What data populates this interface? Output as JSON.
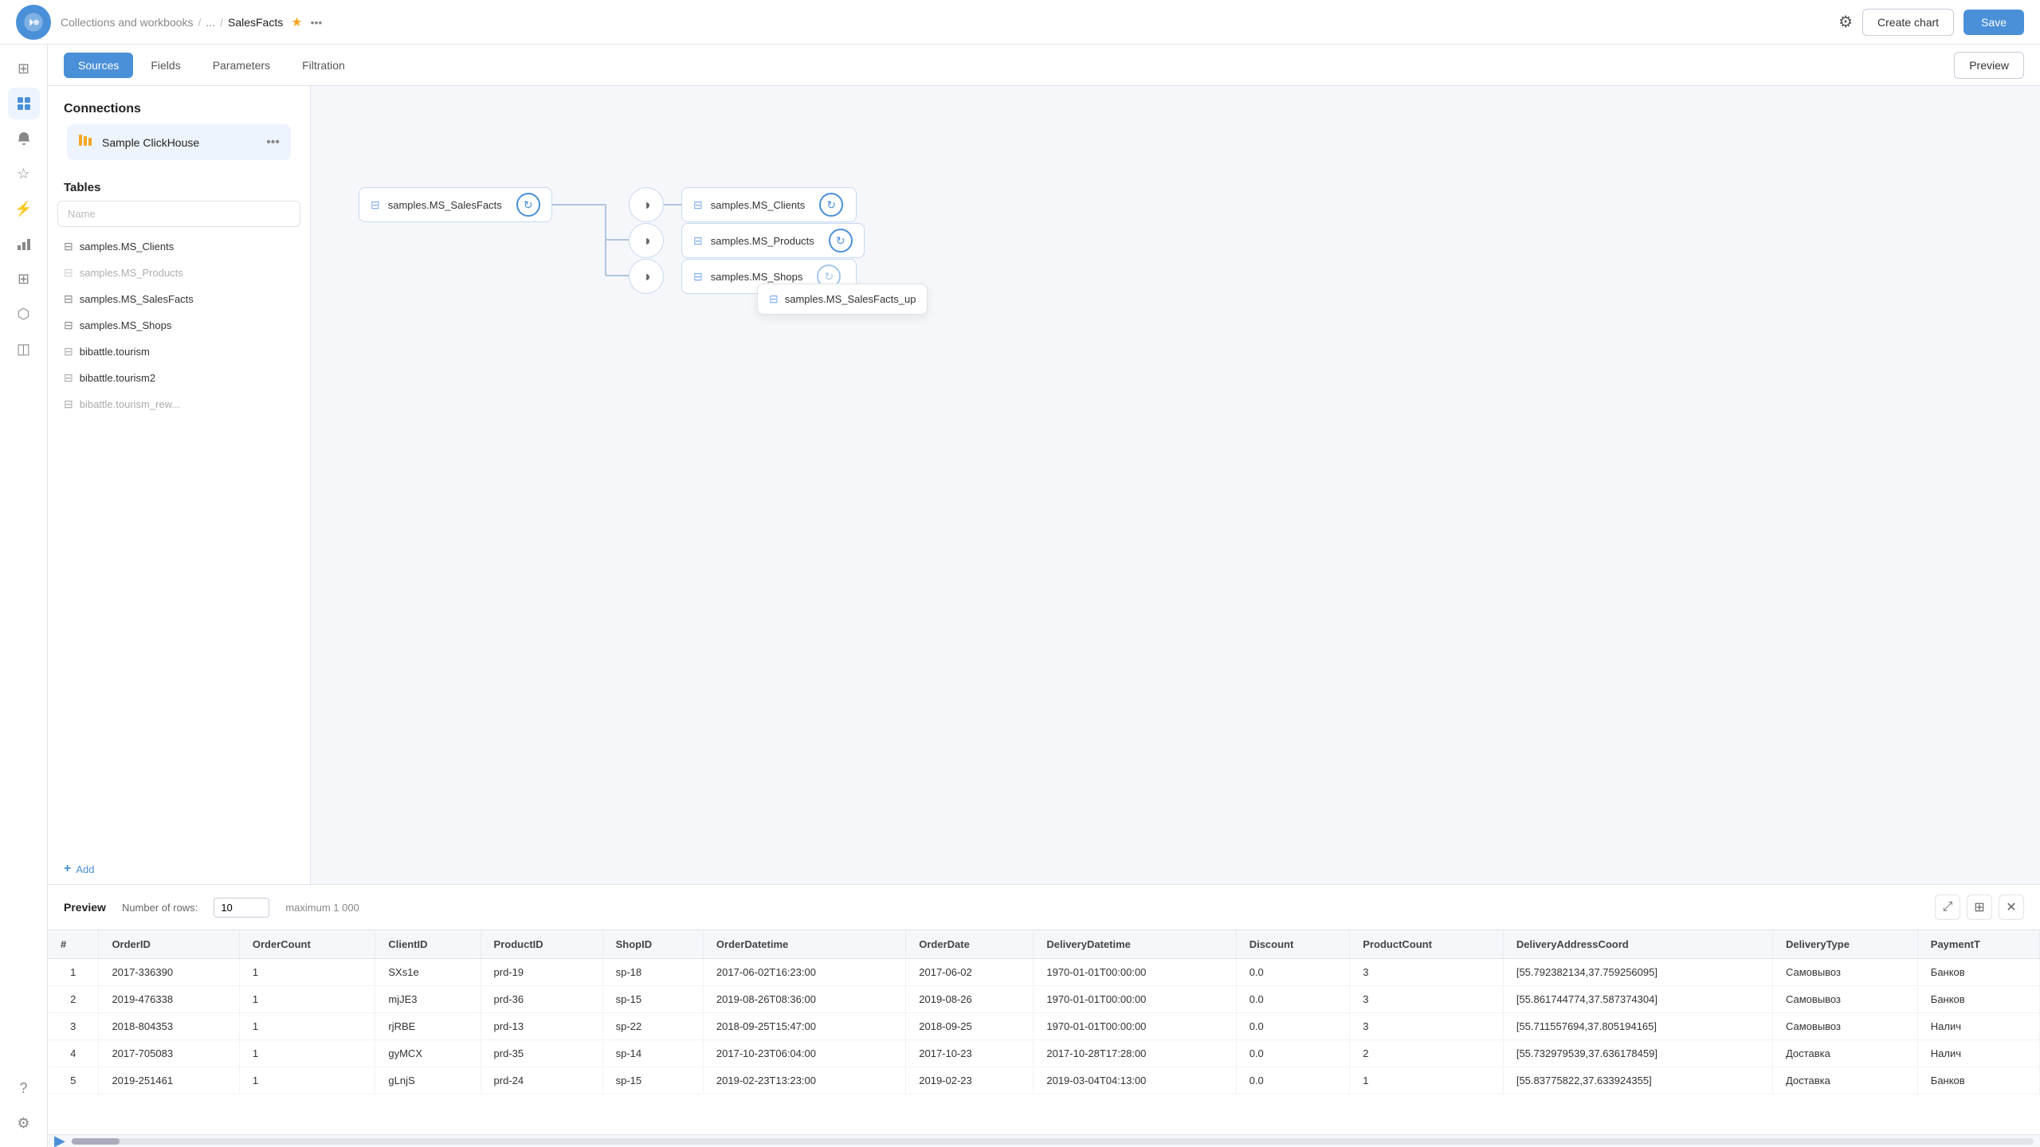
{
  "topbar": {
    "breadcrumb": {
      "parent": "Collections and workbooks",
      "sep1": "/",
      "dots": "...",
      "sep2": "/",
      "current": "SalesFacts"
    },
    "create_chart_label": "Create chart",
    "save_label": "Save"
  },
  "tabs": {
    "sources_label": "Sources",
    "fields_label": "Fields",
    "parameters_label": "Parameters",
    "filtration_label": "Filtration",
    "preview_label": "Preview"
  },
  "sidebar": {
    "connections_title": "Connections",
    "connection_name": "Sample ClickHouse",
    "tables_title": "Tables",
    "search_placeholder": "Name",
    "tables": [
      {
        "name": "samples.MS_Clients",
        "disabled": false
      },
      {
        "name": "samples.MS_Products",
        "disabled": true
      },
      {
        "name": "samples.MS_SalesFacts",
        "disabled": false
      },
      {
        "name": "samples.MS_Shops",
        "disabled": false
      },
      {
        "name": "bibattle.tourism",
        "disabled": false
      },
      {
        "name": "bibattle.tourism2",
        "disabled": false
      },
      {
        "name": "bibattle.tourism_rew...",
        "disabled": false
      }
    ],
    "add_label": "Add"
  },
  "diagram": {
    "node_sales_facts": "samples.MS_SalesFacts",
    "node_clients": "samples.MS_Clients",
    "node_products": "samples.MS_Products",
    "node_shops": "samples.MS_Shops",
    "tooltip_table": "samples.MS_SalesFacts_up"
  },
  "preview": {
    "title": "Preview",
    "rows_label": "Number of rows:",
    "rows_value": "10",
    "max_label": "maximum 1 000",
    "columns": [
      "#",
      "OrderID",
      "OrderCount",
      "ClientID",
      "ProductID",
      "ShopID",
      "OrderDatetime",
      "OrderDate",
      "DeliveryDatetime",
      "Discount",
      "ProductCount",
      "DeliveryAddressCoord",
      "DeliveryType",
      "PaymentT"
    ],
    "rows": [
      [
        "1",
        "2017-336390",
        "1",
        "SXs1e",
        "prd-19",
        "sp-18",
        "2017-06-02T16:23:00",
        "2017-06-02",
        "1970-01-01T00:00:00",
        "0.0",
        "3",
        "[55.792382134,37.759256095]",
        "Самовывоз",
        "Банков"
      ],
      [
        "2",
        "2019-476338",
        "1",
        "mjJE3",
        "prd-36",
        "sp-15",
        "2019-08-26T08:36:00",
        "2019-08-26",
        "1970-01-01T00:00:00",
        "0.0",
        "3",
        "[55.861744774,37.587374304]",
        "Самовывоз",
        "Банков"
      ],
      [
        "3",
        "2018-804353",
        "1",
        "rjRBE",
        "prd-13",
        "sp-22",
        "2018-09-25T15:47:00",
        "2018-09-25",
        "1970-01-01T00:00:00",
        "0.0",
        "3",
        "[55.711557694,37.805194165]",
        "Самовывоз",
        "Налич"
      ],
      [
        "4",
        "2017-705083",
        "1",
        "gyMCX",
        "prd-35",
        "sp-14",
        "2017-10-23T06:04:00",
        "2017-10-23",
        "2017-10-28T17:28:00",
        "0.0",
        "2",
        "[55.732979539,37.636178459]",
        "Доставка",
        "Налич"
      ],
      [
        "5",
        "2019-251461",
        "1",
        "gLnjS",
        "prd-24",
        "sp-15",
        "2019-02-23T13:23:00",
        "2019-02-23",
        "2019-03-04T04:13:00",
        "0.0",
        "1",
        "[55.83775822,37.633924355]",
        "Доставка",
        "Банков"
      ]
    ]
  },
  "icons": {
    "grid": "⊞",
    "bell": "🔔",
    "question": "?",
    "settings": "⚙",
    "star_nav": "☆",
    "flash": "⚡",
    "chart_bar": "📊",
    "grid2": "⊞",
    "puzzle": "🧩",
    "layers": "◫",
    "connection": "⊙",
    "wrench": "⚙",
    "table_icon": "⊟",
    "refresh": "↻",
    "join": "◑",
    "close": "✕",
    "expand": "⤢",
    "cols": "⊞",
    "play": "▶"
  },
  "colors": {
    "accent": "#4a90d9",
    "active_tab_bg": "#4a90d9",
    "connection_icon": "#f5a623"
  }
}
